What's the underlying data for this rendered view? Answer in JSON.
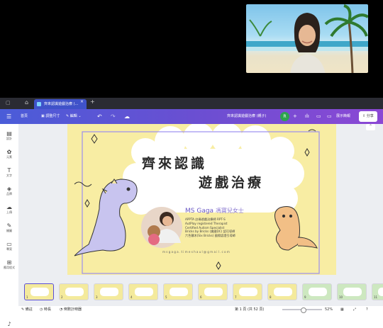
{
  "browser": {
    "tab_title": "齊來認識遊戲治療 (..."
  },
  "toolbar": {
    "home_label": "首頁",
    "resize_label": "調整尺寸",
    "edit_label": "編輯",
    "doc_title": "齊來認識遊戲治療 (親子)",
    "user_initial": "R",
    "present_label": "展示簡報",
    "share_label": "分享"
  },
  "sidebar": {
    "items": [
      {
        "icon": "layout-icon",
        "label": "設計"
      },
      {
        "icon": "elements-icon",
        "label": "元素"
      },
      {
        "icon": "text-icon",
        "label": "文字"
      },
      {
        "icon": "brand-icon",
        "label": "品牌"
      },
      {
        "icon": "upload-icon",
        "label": "上傳"
      },
      {
        "icon": "draw-icon",
        "label": "繪圖"
      },
      {
        "icon": "projects-icon",
        "label": "專案"
      },
      {
        "icon": "apps-icon",
        "label": "應用程式"
      }
    ]
  },
  "slide": {
    "title_line1": "齊來認識",
    "title_line2": "遊戲治療",
    "presenter_name": "MS Gaga",
    "presenter_name_zh": "馮寶兒女士",
    "credentials": [
      "APPTA 註冊遊戲治療師 RPT-S",
      "AutPlay registered Therapist",
      "Certified Autism Specialist",
      "Bricks by Bricks (美國DC) 認可導師",
      "六色積木(Six Bricks) 國際認證引導師"
    ],
    "email": "msgaga.timeshaul@gmail.com"
  },
  "thumbnails": [
    {
      "num": "1",
      "selected": true
    },
    {
      "num": "2"
    },
    {
      "num": "3"
    },
    {
      "num": "4"
    },
    {
      "num": "5"
    },
    {
      "num": "6"
    },
    {
      "num": "7"
    },
    {
      "num": "8"
    },
    {
      "num": "9"
    },
    {
      "num": "10"
    },
    {
      "num": "11"
    }
  ],
  "status": {
    "notes_label": "備註",
    "duration_label": "時長",
    "timer_label": "倒數計時器",
    "page_label": "第 1 頁 (共 52 頁)",
    "zoom": "52%"
  },
  "colors": {
    "toolbar_start": "#4a5cd8",
    "toolbar_end": "#8b48d4",
    "slide_bg": "#f8eda3",
    "accent": "#7b6fd6"
  }
}
